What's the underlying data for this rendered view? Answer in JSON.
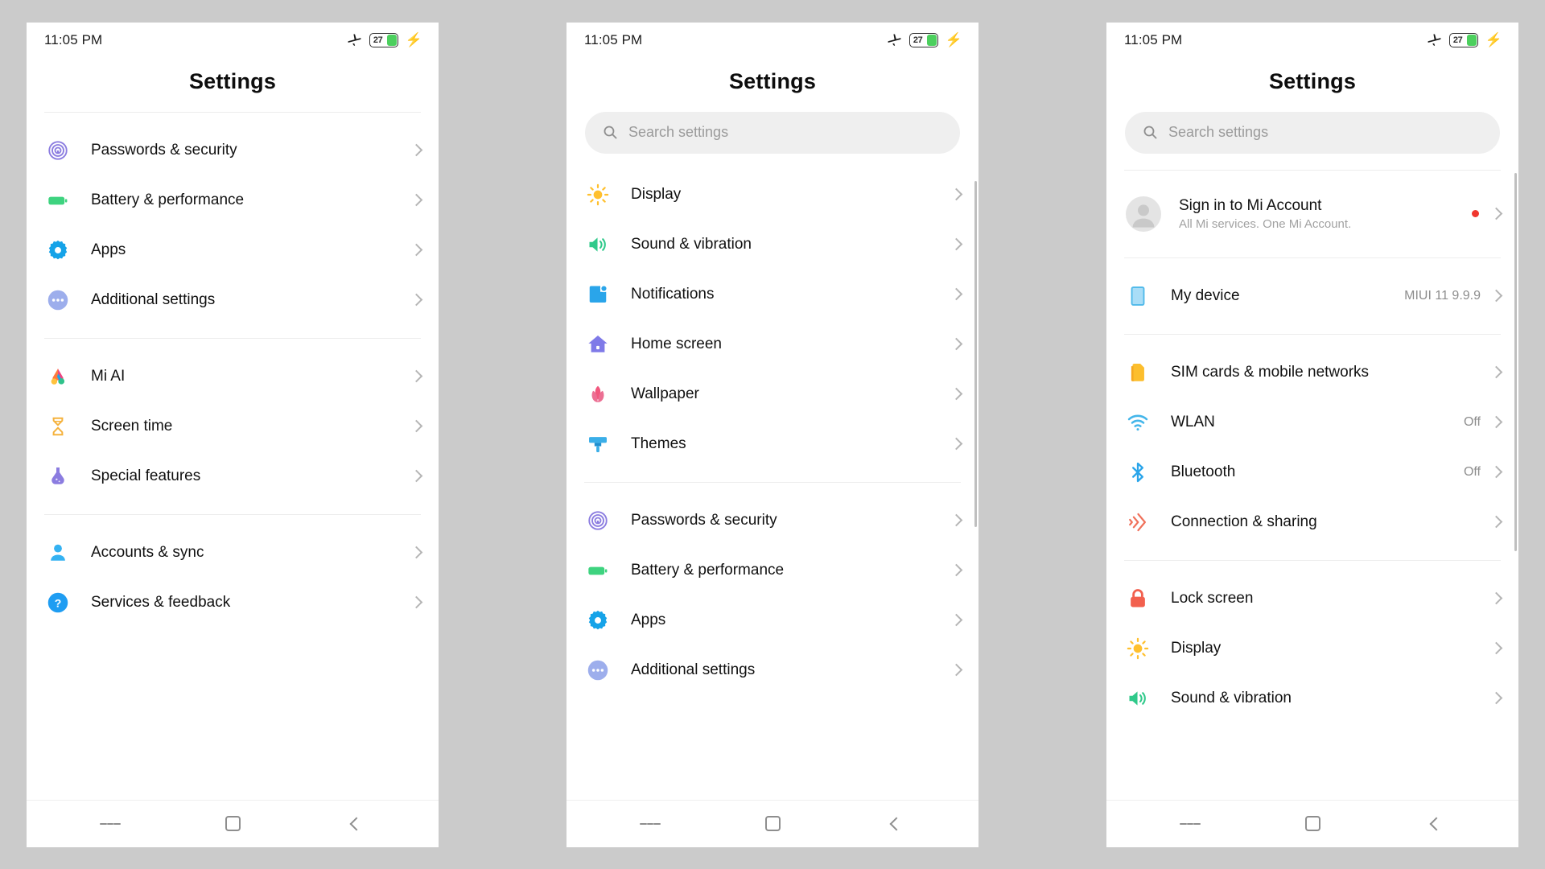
{
  "status_bar": {
    "time": "11:05 PM",
    "battery_percent": "27",
    "icons": [
      "airplane-mode-icon",
      "battery-icon",
      "charging-bolt-icon"
    ]
  },
  "app_title": "Settings",
  "search": {
    "placeholder": "Search settings",
    "icon": "search-icon"
  },
  "nav_bar": {
    "menu": "menu-button",
    "home": "home-button",
    "back": "back-button"
  },
  "panels": [
    {
      "id": "panel-1",
      "has_search": false,
      "groups": [
        {
          "items": [
            {
              "label": "Passwords & security",
              "icon": "fingerprint-icon",
              "value": ""
            },
            {
              "label": "Battery & performance",
              "icon": "battery-icon",
              "value": ""
            },
            {
              "label": "Apps",
              "icon": "gear-icon",
              "value": ""
            },
            {
              "label": "Additional settings",
              "icon": "more-dots-icon",
              "value": ""
            }
          ]
        },
        {
          "items": [
            {
              "label": "Mi AI",
              "icon": "mi-ai-icon",
              "value": ""
            },
            {
              "label": "Screen time",
              "icon": "hourglass-icon",
              "value": ""
            },
            {
              "label": "Special features",
              "icon": "flask-icon",
              "value": ""
            }
          ]
        },
        {
          "items": [
            {
              "label": "Accounts & sync",
              "icon": "person-icon",
              "value": ""
            },
            {
              "label": "Services & feedback",
              "icon": "question-circle-icon",
              "value": ""
            }
          ]
        }
      ]
    },
    {
      "id": "panel-2",
      "has_search": true,
      "groups": [
        {
          "items": [
            {
              "label": "Display",
              "icon": "sun-icon",
              "value": ""
            },
            {
              "label": "Sound & vibration",
              "icon": "speaker-icon",
              "value": ""
            },
            {
              "label": "Notifications",
              "icon": "notification-icon",
              "value": ""
            },
            {
              "label": "Home screen",
              "icon": "house-icon",
              "value": ""
            },
            {
              "label": "Wallpaper",
              "icon": "flower-icon",
              "value": ""
            },
            {
              "label": "Themes",
              "icon": "brush-icon",
              "value": ""
            }
          ]
        },
        {
          "items": [
            {
              "label": "Passwords & security",
              "icon": "fingerprint-icon",
              "value": ""
            },
            {
              "label": "Battery & performance",
              "icon": "battery-icon",
              "value": ""
            },
            {
              "label": "Apps",
              "icon": "gear-icon",
              "value": ""
            },
            {
              "label": "Additional settings",
              "icon": "more-dots-icon",
              "value": ""
            }
          ]
        }
      ]
    },
    {
      "id": "panel-3",
      "has_search": true,
      "account": {
        "title": "Sign in to Mi Account",
        "subtitle": "All Mi services. One Mi Account.",
        "icon": "avatar-icon",
        "badge": true
      },
      "groups": [
        {
          "items": [
            {
              "label": "My device",
              "icon": "device-icon",
              "value": "MIUI 11 9.9.9"
            }
          ]
        },
        {
          "items": [
            {
              "label": "SIM cards & mobile networks",
              "icon": "sim-card-icon",
              "value": ""
            },
            {
              "label": "WLAN",
              "icon": "wifi-icon",
              "value": "Off"
            },
            {
              "label": "Bluetooth",
              "icon": "bluetooth-icon",
              "value": "Off"
            },
            {
              "label": "Connection & sharing",
              "icon": "connection-sharing-icon",
              "value": ""
            }
          ]
        },
        {
          "items": [
            {
              "label": "Lock screen",
              "icon": "lock-icon",
              "value": ""
            },
            {
              "label": "Display",
              "icon": "sun-icon",
              "value": ""
            },
            {
              "label": "Sound & vibration",
              "icon": "speaker-icon",
              "value": ""
            }
          ]
        }
      ]
    }
  ],
  "colors": {
    "background": "#cbcbcb",
    "panel": "#ffffff",
    "accent_red": "#f0372e",
    "battery_green": "#4cd05e",
    "muted_text": "#8d8d8d"
  }
}
